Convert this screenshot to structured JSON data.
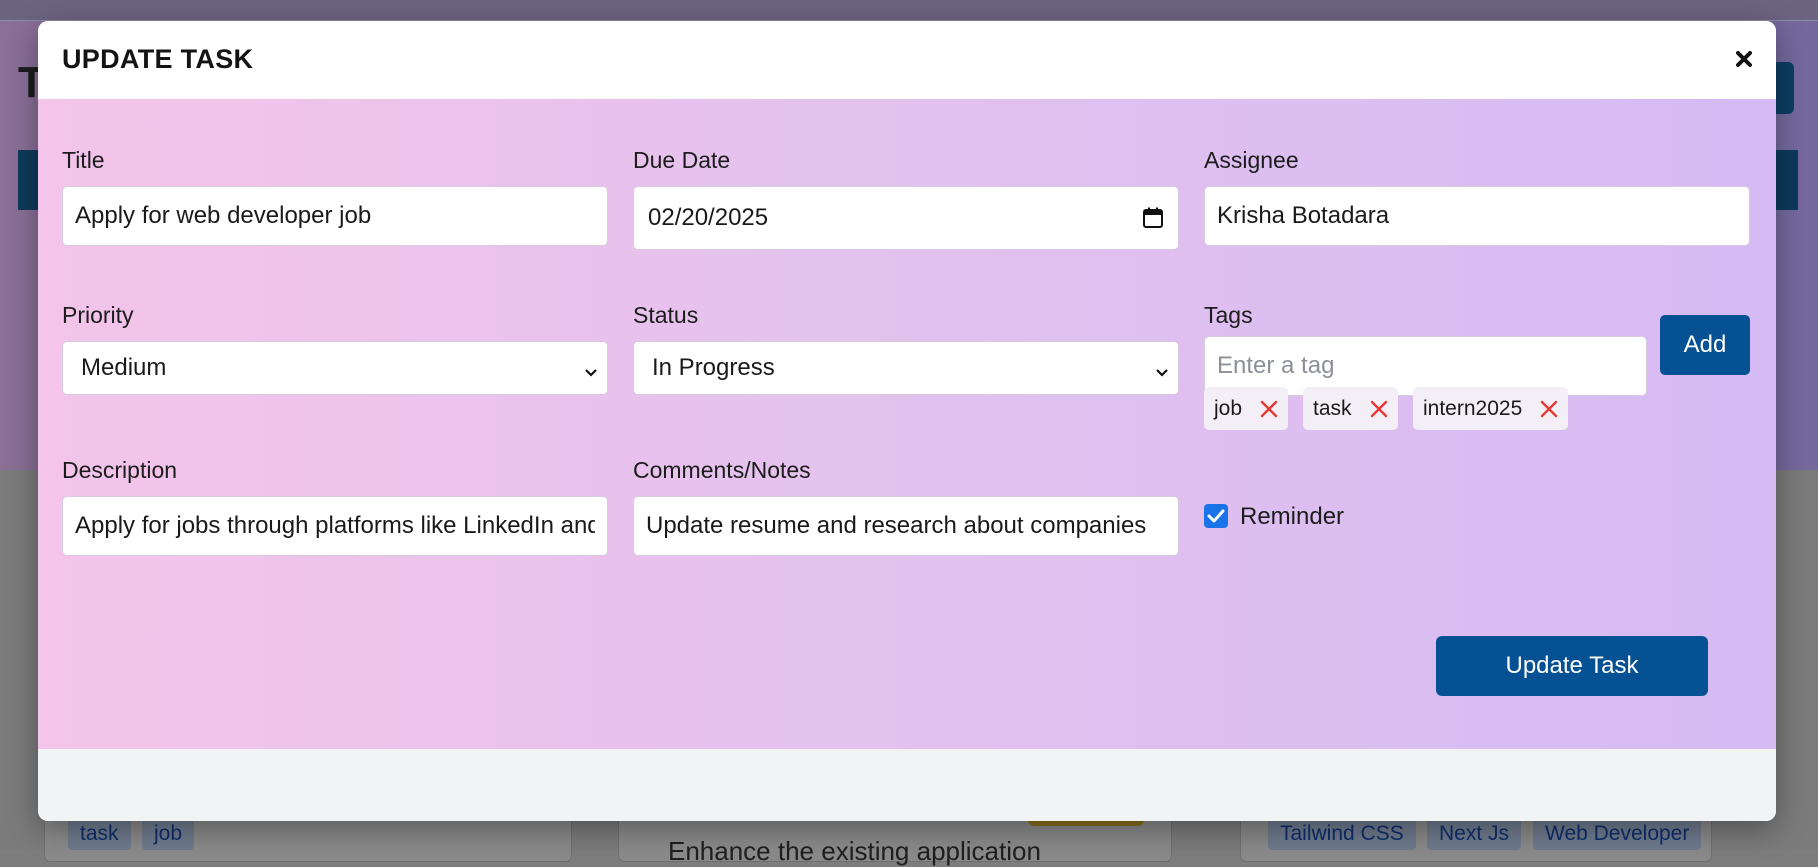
{
  "background": {
    "heading_fragment": "T",
    "chips_left": [
      "task",
      "job"
    ],
    "chips_right": [
      "Tailwind CSS",
      "Next Js",
      "Web Developer"
    ],
    "cut_text": "Enhance the existing application"
  },
  "modal": {
    "title": "UPDATE TASK",
    "close_icon": "close-icon",
    "form": {
      "title": {
        "label": "Title",
        "value": "Apply for web developer job"
      },
      "due_date": {
        "label": "Due Date",
        "value": "02/20/2025"
      },
      "assignee": {
        "label": "Assignee",
        "value": "Krisha Botadara"
      },
      "priority": {
        "label": "Priority",
        "selected": "Medium"
      },
      "status": {
        "label": "Status",
        "selected": "In Progress"
      },
      "tags": {
        "label": "Tags",
        "placeholder": "Enter a tag",
        "add_label": "Add",
        "items": [
          "job",
          "task",
          "intern2025"
        ]
      },
      "description": {
        "label": "Description",
        "value": "Apply for jobs through platforms like LinkedIn and"
      },
      "comments": {
        "label": "Comments/Notes",
        "value": "Update resume and research about companies"
      },
      "reminder": {
        "label": "Reminder",
        "checked": true
      },
      "submit_label": "Update Task"
    }
  },
  "colors": {
    "primary_button": "#055193",
    "remove_icon": "#e53935",
    "checkbox": "#1a73e8",
    "gradient_start": "#f4c4ea",
    "gradient_end": "#d5baf3"
  }
}
